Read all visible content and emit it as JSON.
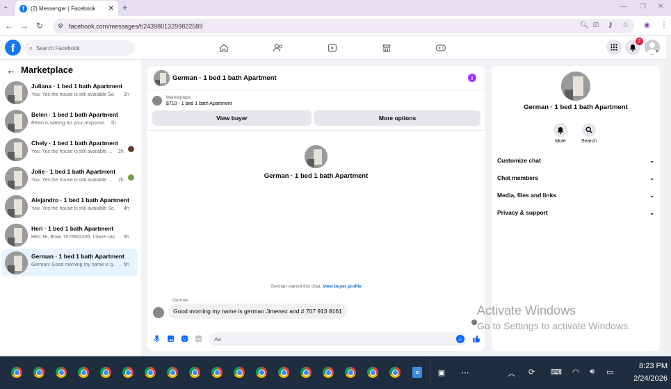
{
  "browser": {
    "tab_title": "(2) Messenger | Facebook",
    "tab_favicon": "facebook-icon",
    "url": "facebook.com/messages/t/24398013299822589",
    "new_tab": "+",
    "tab_close": "✕"
  },
  "facebook": {
    "logo": "f",
    "search_placeholder": "Search Facebook",
    "notification_count": "2",
    "nav_icons": [
      "home-icon",
      "friends-icon",
      "video-icon",
      "marketplace-icon",
      "gaming-icon"
    ],
    "accent": "#1877f2"
  },
  "sidebar": {
    "title": "Marketplace",
    "chats": [
      {
        "name": "Juliana · 1 bed 1 bath Apartment",
        "preview": "You: Yes the house is still available Se...",
        "time": "1h",
        "active": false
      },
      {
        "name": "Belen · 1 bed 1 bath Apartment",
        "preview": "Belen is waiting for your response.",
        "time": "1h",
        "active": false
      },
      {
        "name": "Chely · 1 bed 1 bath Apartment",
        "preview": "You: Yes the house is still available ...",
        "time": "2h",
        "active": false
      },
      {
        "name": "Jolie · 1 bed 1 bath Apartment",
        "preview": "You: Yes the house is still available ...",
        "time": "2h",
        "active": false
      },
      {
        "name": "Alejandro · 1 bed 1 bath Apartment",
        "preview": "You: Yes the house is still available Se...",
        "time": "4h",
        "active": false
      },
      {
        "name": "Heri · 1 bed 1 bath Apartment",
        "preview": "Heri: Hi, Brian 7076902206. I have cas...",
        "time": "5h",
        "active": false
      },
      {
        "name": "German · 1 bed 1 bath Apartment",
        "preview": "German: Good morning my name is g...",
        "time": "5h",
        "active": true
      }
    ]
  },
  "chat": {
    "header_name": "German · 1 bed 1 bath Apartment",
    "listing_label": "Marketplace",
    "listing_price": "$710 - 1 bed 1 bath Apartment",
    "view_buyer": "View buyer",
    "more_options": "More options",
    "center_name": "German · 1 bed 1 bath Apartment",
    "started_text": "German started this chat.",
    "view_buyer_profile": "View buyer profile",
    "sender": "German",
    "message": "Good morning my name is german Jimenez and # 707 913 8161",
    "composer_placeholder": "Aa"
  },
  "right_panel": {
    "name": "German · 1 bed 1 bath Apartment",
    "mute_label": "Mute",
    "search_label": "Search",
    "sections": [
      "Customize chat",
      "Chat members",
      "Media, files and links",
      "Privacy & support"
    ]
  },
  "watermark": {
    "line1": "Activate Windows",
    "line2": "Go to Settings to activate Windows."
  },
  "taskbar": {
    "time": "8:23 PM",
    "date": "2/24/2026"
  }
}
